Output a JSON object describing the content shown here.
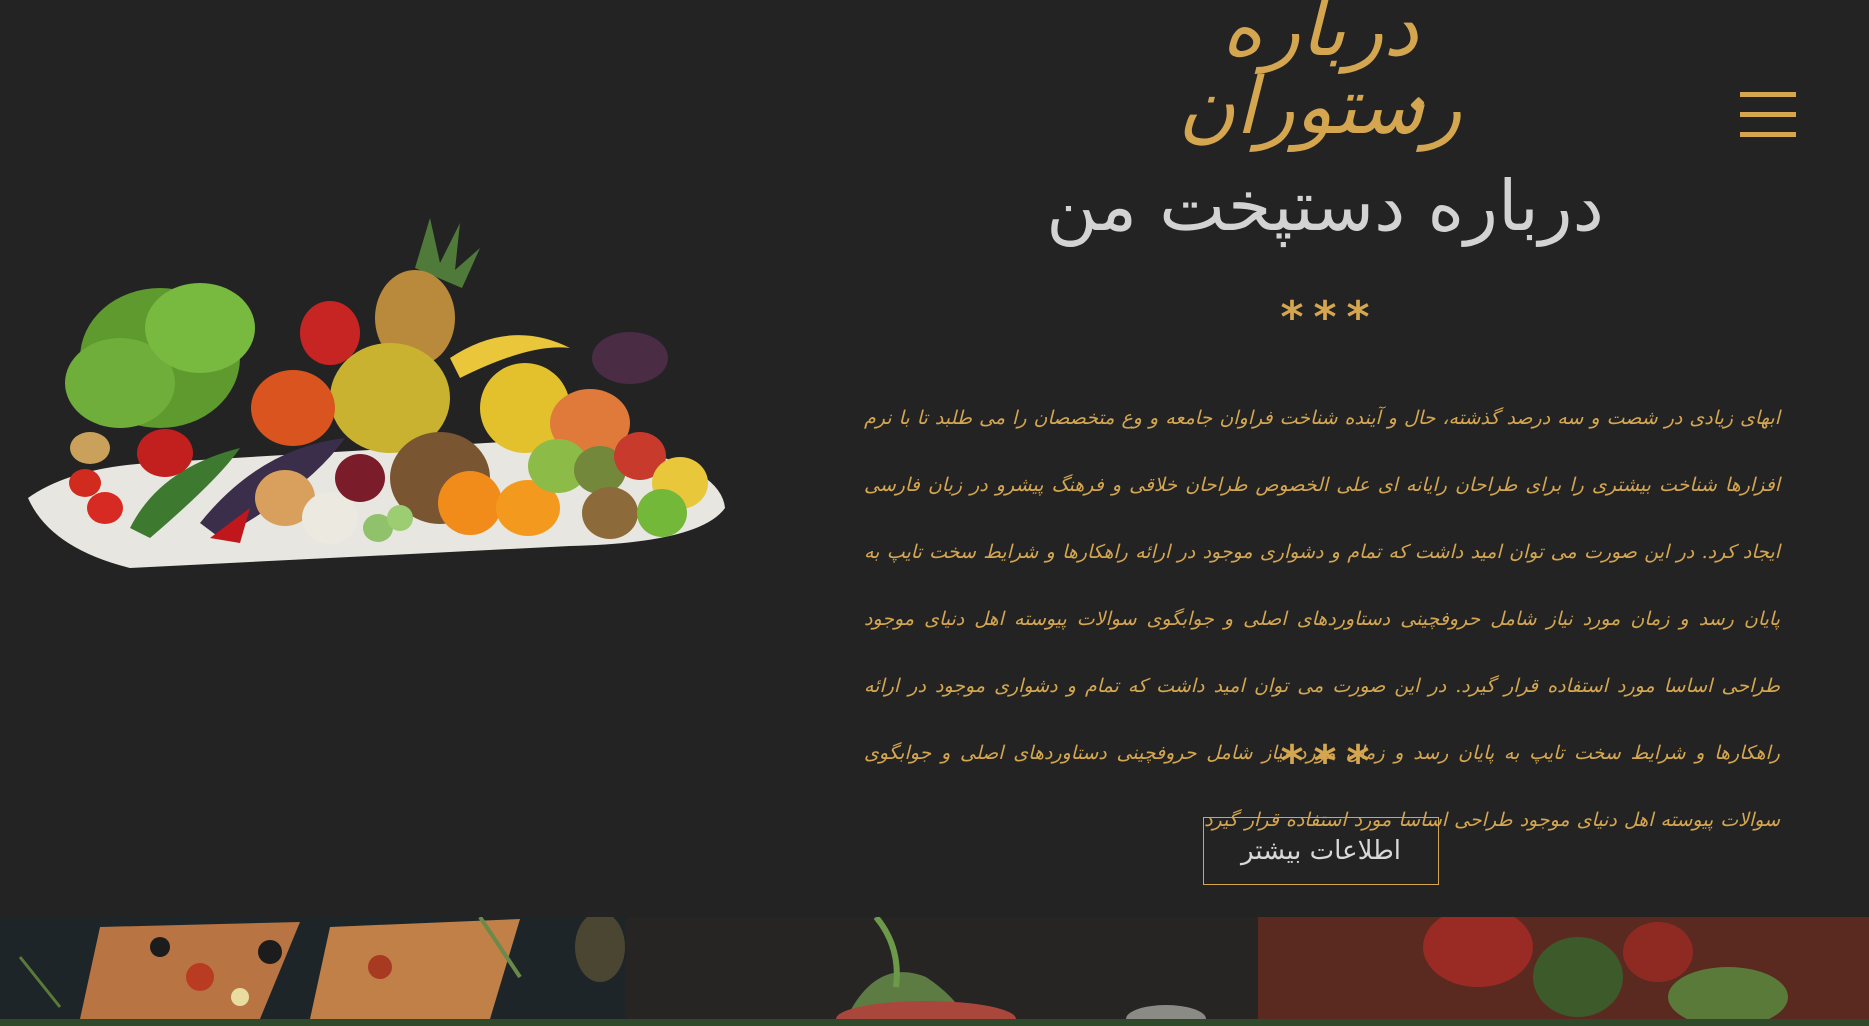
{
  "header": {
    "script_title": "درباره رستوران",
    "menu_icon": "hamburger-menu-icon"
  },
  "about": {
    "heading": "درباره دستپخت من",
    "ornament": "***",
    "paragraph": "ابهای زیادی در شصت و سه درصد گذشته، حال و آینده شناخت فراوان جامعه و وع متخصصان را می طلبد تا با نرم افزارها شناخت بیشتری را برای طراحان رایانه ای علی الخصوص طراحان خلاقی و فرهنگ پیشرو در زبان فارسی ایجاد کرد. در این صورت می توان امید داشت که تمام و دشواری موجود در ارائه راهکارها و شرایط سخت تایپ به پایان رسد و زمان مورد نیاز شامل حروفچینی دستاوردهای اصلی و جوابگوی سوالات پیوسته اهل دنیای موجود طراحی اساسا مورد استفاده قرار گیرد. در این صورت می توان امید داشت که تمام و دشواری موجود در ارائه راهکارها و شرایط سخت تایپ به پایان رسد و زمان مورد نیاز شامل حروفچینی دستاوردهای اصلی و جوابگوی سوالات پیوسته اهل دنیای موجود طراحی اساسا مورد استفاده قرار گیرد",
    "more_button": "اطلاعات بیشتر"
  },
  "images": {
    "main": "fruits-and-vegetables-platter",
    "gallery": [
      "pizza-photo",
      "dessert-photo",
      "salad-photo"
    ]
  },
  "colors": {
    "background": "#232324",
    "accent": "#d4a650",
    "heading": "#d3d3d3"
  }
}
